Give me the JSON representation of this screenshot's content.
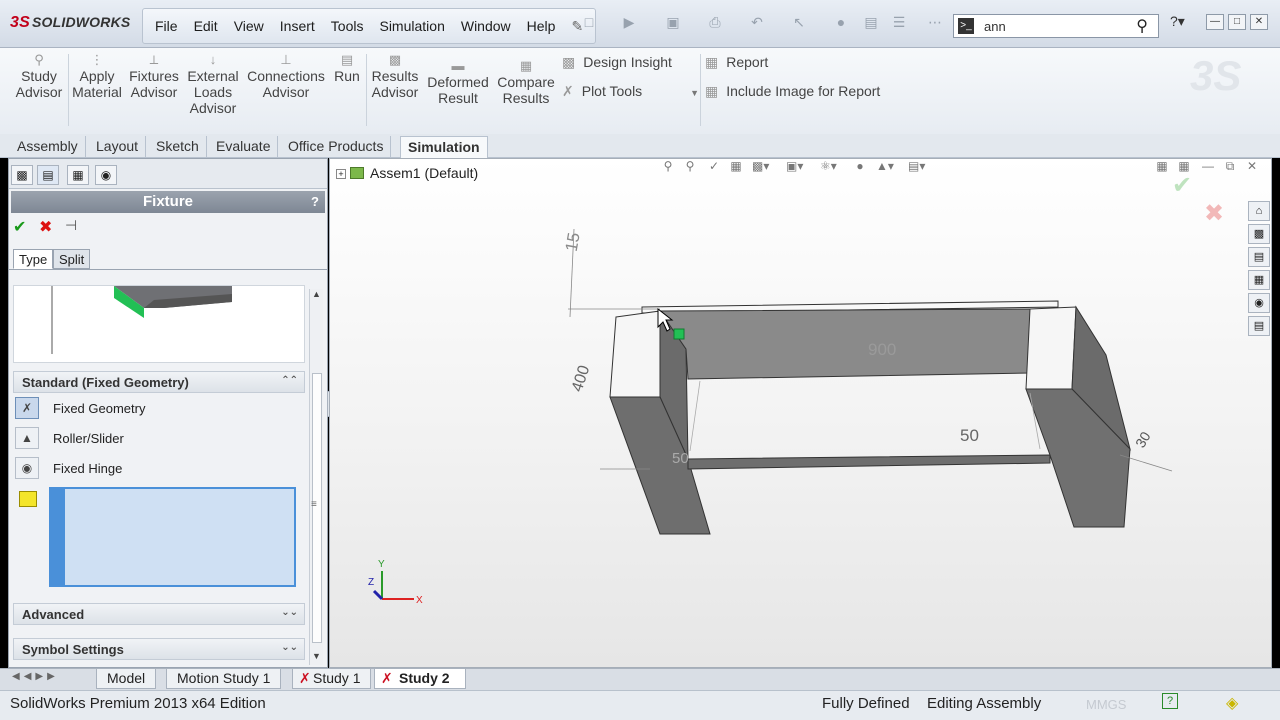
{
  "app": {
    "logo_text": "SOLIDWORKS",
    "logo_prefix": "3S"
  },
  "menubar": {
    "items": [
      "File",
      "Edit",
      "View",
      "Insert",
      "Tools",
      "Simulation",
      "Window",
      "Help"
    ]
  },
  "search": {
    "value": "ann",
    "icon": "search-icon"
  },
  "ribbon": {
    "buttons": [
      {
        "label": "Study\nAdvisor",
        "icon": "study-advisor-icon"
      },
      {
        "label": "Apply\nMaterial",
        "icon": "apply-material-icon"
      },
      {
        "label": "Fixtures\nAdvisor",
        "icon": "fixtures-advisor-icon"
      },
      {
        "label": "External\nLoads\nAdvisor",
        "icon": "external-loads-icon"
      },
      {
        "label": "Connections\nAdvisor",
        "icon": "connections-icon"
      },
      {
        "label": "Run",
        "icon": "run-icon"
      },
      {
        "label": "Results\nAdvisor",
        "icon": "results-advisor-icon"
      },
      {
        "label": "Deformed\nResult",
        "icon": "deformed-result-icon"
      },
      {
        "label": "Compare\nResults",
        "icon": "compare-results-icon"
      }
    ],
    "design_insight": "Design Insight",
    "plot_tools": "Plot Tools",
    "report": "Report",
    "include_image": "Include Image for Report"
  },
  "command_tabs": [
    {
      "label": "Assembly",
      "active": false
    },
    {
      "label": "Layout",
      "active": false
    },
    {
      "label": "Sketch",
      "active": false
    },
    {
      "label": "Evaluate",
      "active": false
    },
    {
      "label": "Office Products",
      "active": false
    },
    {
      "label": "Simulation",
      "active": true
    }
  ],
  "property_manager": {
    "title": "Fixture",
    "help": "?",
    "subtabs": [
      {
        "label": "Type",
        "active": true
      },
      {
        "label": "Split",
        "active": false
      }
    ],
    "standard_group": "Standard (Fixed Geometry)",
    "fixture_types": [
      {
        "label": "Fixed Geometry",
        "icon": "fixed-geometry-icon",
        "selected": true
      },
      {
        "label": "Roller/Slider",
        "icon": "roller-slider-icon",
        "selected": false
      },
      {
        "label": "Fixed Hinge",
        "icon": "fixed-hinge-icon",
        "selected": false
      }
    ],
    "advanced_group": "Advanced",
    "symbol_group": "Symbol Settings"
  },
  "viewport": {
    "tree_root": "Assem1  (Default)",
    "dimensions": {
      "length": "900",
      "height": "15",
      "depth": "400",
      "thickness": "50",
      "leg": "50",
      "side": "30"
    },
    "axes": {
      "x": "X",
      "y": "Y",
      "z": "Z"
    }
  },
  "bottom_tabs": [
    {
      "label": "Model",
      "active": false
    },
    {
      "label": "Motion Study 1",
      "active": false
    },
    {
      "label": "Study 1",
      "active": false
    },
    {
      "label": "Study 2",
      "active": true
    }
  ],
  "status": {
    "edition": "SolidWorks Premium 2013 x64 Edition",
    "definition": "Fully Defined",
    "mode": "Editing Assembly",
    "units": "MMGS"
  },
  "colors": {
    "accent": "#c2001a",
    "selection": "#4a90d9",
    "face_highlight": "#22c055"
  }
}
